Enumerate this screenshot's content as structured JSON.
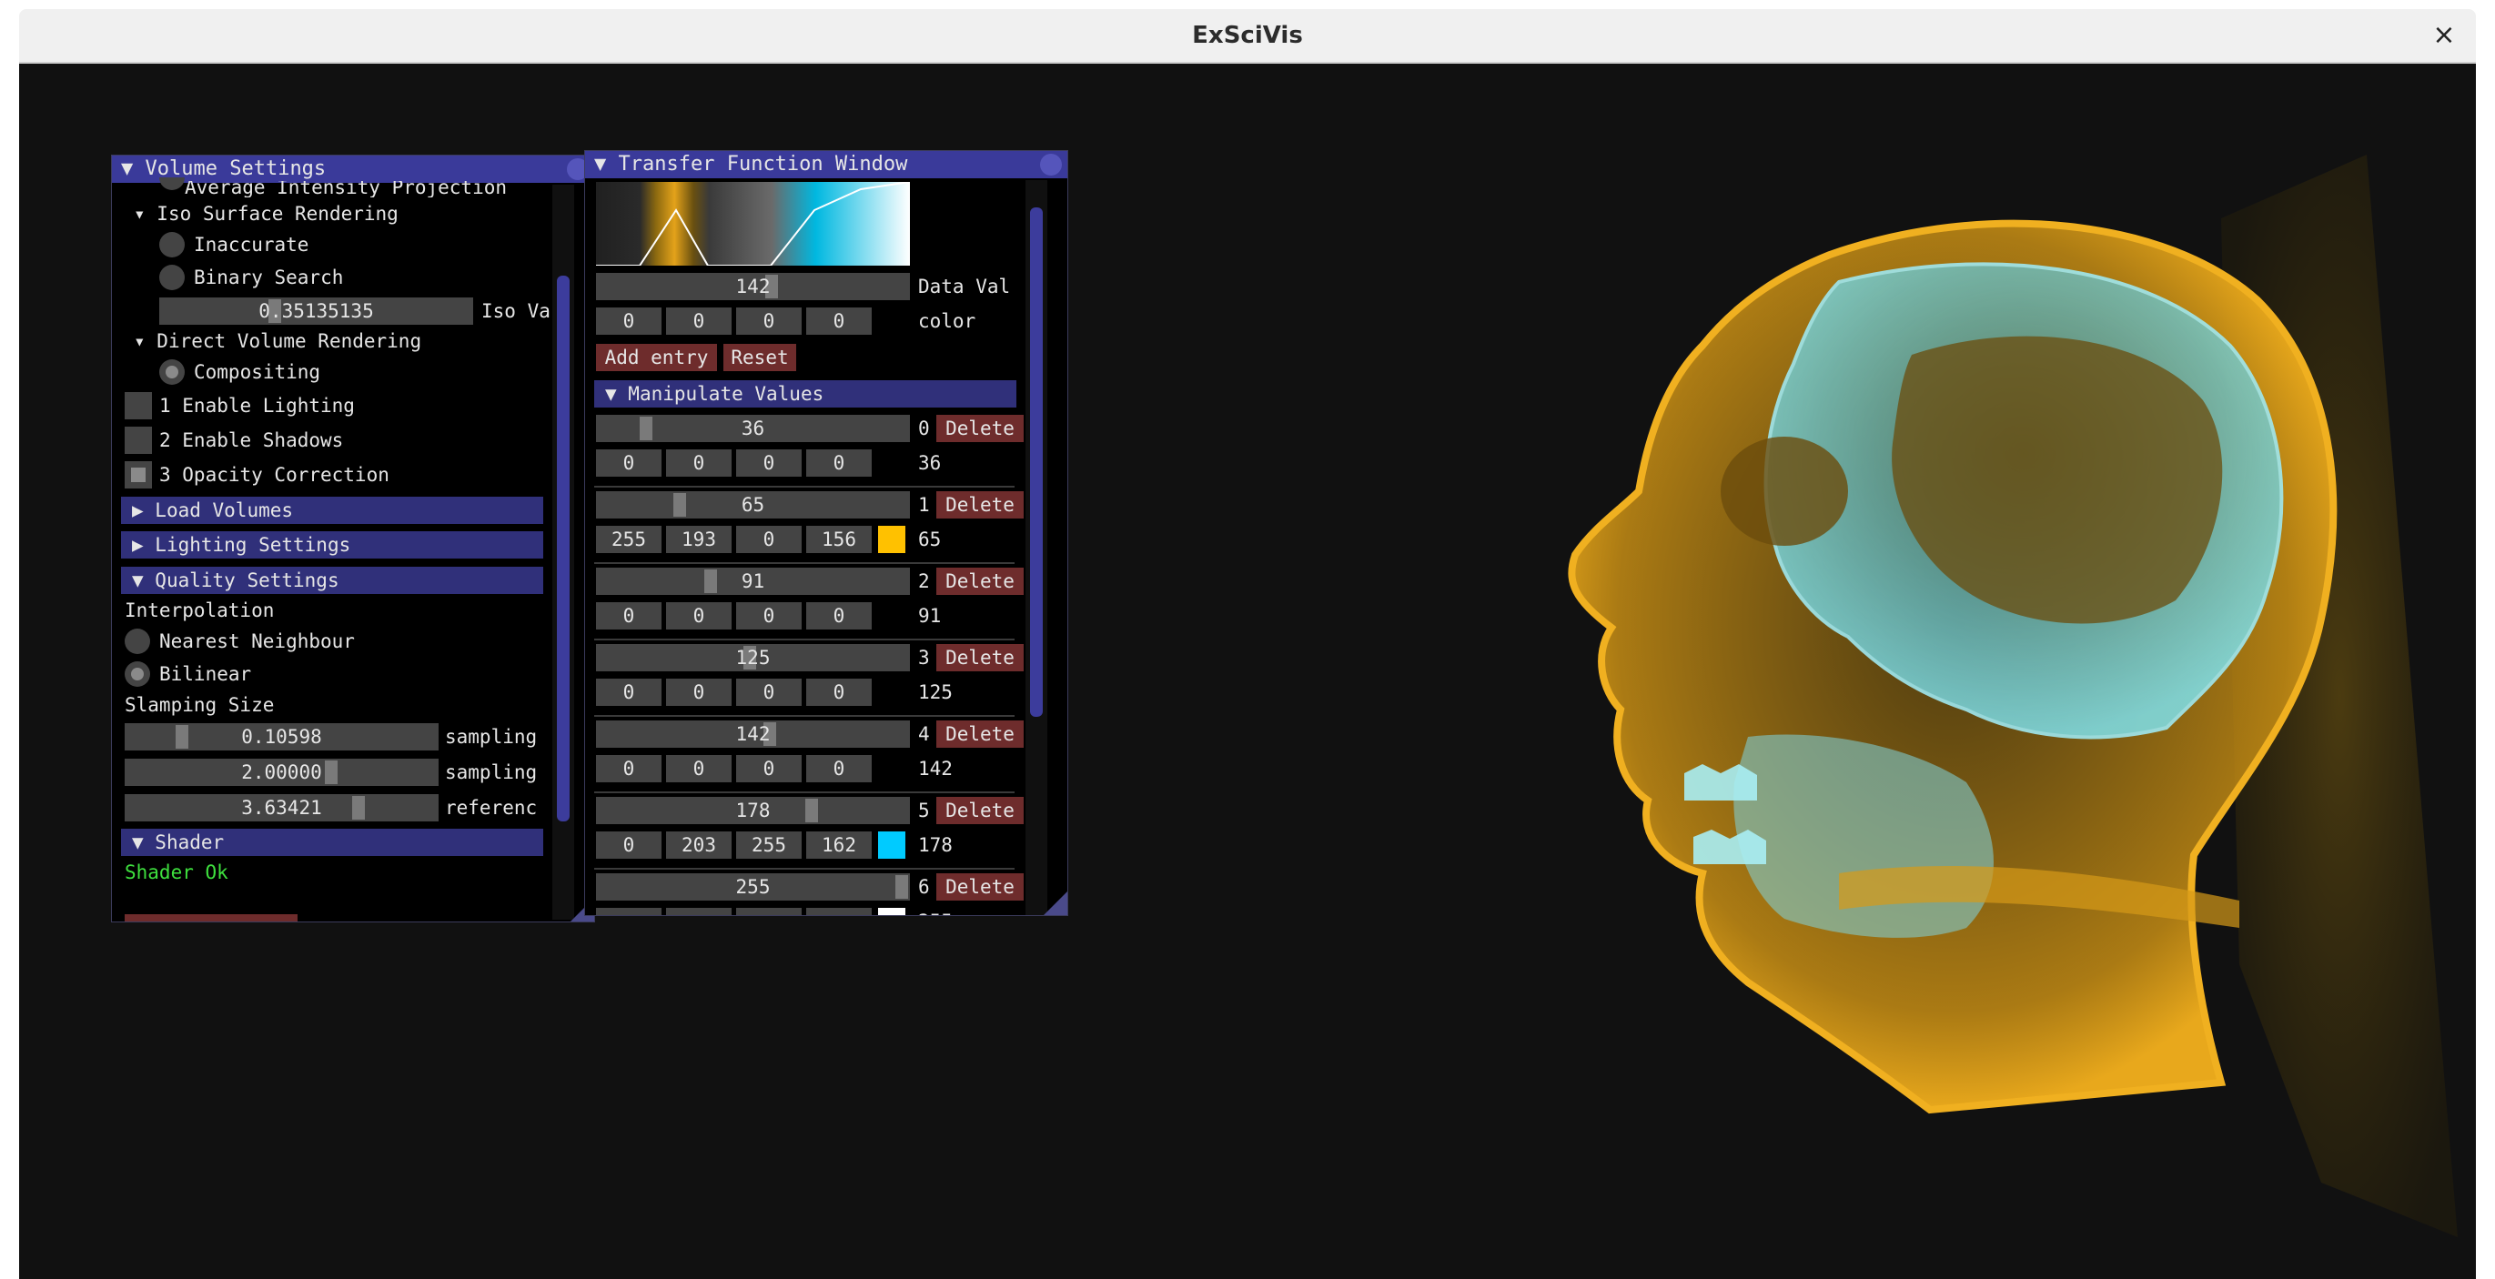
{
  "window": {
    "title": "ExSciVis",
    "close_glyph": "×"
  },
  "volume_settings": {
    "title": "Volume Settings",
    "clipped_item": "Average Intensity Projection",
    "iso_header": "Iso Surface Rendering",
    "inaccurate": "Inaccurate",
    "binary_search": "Binary Search",
    "iso_value": "0.35135135",
    "iso_value_label": "Iso Va",
    "dvr_header": "Direct Volume Rendering",
    "compositing": "Compositing",
    "enable_lighting": "1 Enable Lighting",
    "enable_shadows": "2 Enable Shadows",
    "opacity_correction": "3 Opacity Correction",
    "load_volumes": "Load Volumes",
    "lighting_settings": "Lighting Settings",
    "quality_settings": "Quality Settings",
    "interpolation": "Interpolation",
    "nearest": "Nearest Neighbour",
    "bilinear": "Bilinear",
    "sampling_size": "Slamping Size",
    "sampling_1": {
      "value": "0.10598",
      "label": "sampling"
    },
    "sampling_2": {
      "value": "2.00000",
      "label": "sampling"
    },
    "reference": {
      "value": "3.63421",
      "label": "referenc"
    },
    "shader_header": "Shader",
    "shader_status": "Shader Ok"
  },
  "transfer_function": {
    "title": "Transfer Function Window",
    "data_value": "142",
    "data_value_label": "Data Val",
    "color_values": [
      "0",
      "0",
      "0",
      "0"
    ],
    "color_label": "color",
    "add_entry": "Add entry",
    "reset": "Reset",
    "manipulate_header": "Manipulate Values",
    "delete_label": "Delete",
    "entries": [
      {
        "index": "0",
        "value": "36",
        "rgba": [
          "0",
          "0",
          "0",
          "0"
        ],
        "swatch": "#000000",
        "fraction": 0.141
      },
      {
        "index": "1",
        "value": "65",
        "rgba": [
          "255",
          "193",
          "0",
          "156"
        ],
        "swatch": "#ffc100",
        "fraction": 0.255
      },
      {
        "index": "2",
        "value": "91",
        "rgba": [
          "0",
          "0",
          "0",
          "0"
        ],
        "swatch": "#000000",
        "fraction": 0.357
      },
      {
        "index": "3",
        "value": "125",
        "rgba": [
          "0",
          "0",
          "0",
          "0"
        ],
        "swatch": "#000000",
        "fraction": 0.49
      },
      {
        "index": "4",
        "value": "142",
        "rgba": [
          "0",
          "0",
          "0",
          "0"
        ],
        "swatch": "#000000",
        "fraction": 0.557
      },
      {
        "index": "5",
        "value": "178",
        "rgba": [
          "0",
          "203",
          "255",
          "162"
        ],
        "swatch": "#00cbff",
        "fraction": 0.698
      },
      {
        "index": "6",
        "value": "255",
        "rgba": [
          "",
          "",
          "",
          ""
        ],
        "swatch": "#ffffff",
        "fraction": 1.0
      }
    ]
  },
  "colors": {
    "panel_bg": "#000000",
    "title_bar": "#3a3a9a",
    "header": "#30307a",
    "delete_button": "#6e2c2c",
    "shader_ok": "#3ee03e",
    "bone": "#e3a21a",
    "tissue": "#6fd3df"
  },
  "icons": {
    "close": "close-icon",
    "expanded": "triangle-down-icon",
    "collapsed": "triangle-right-icon",
    "collapse_window": "circle-button-icon",
    "resize": "resize-grip-icon"
  }
}
